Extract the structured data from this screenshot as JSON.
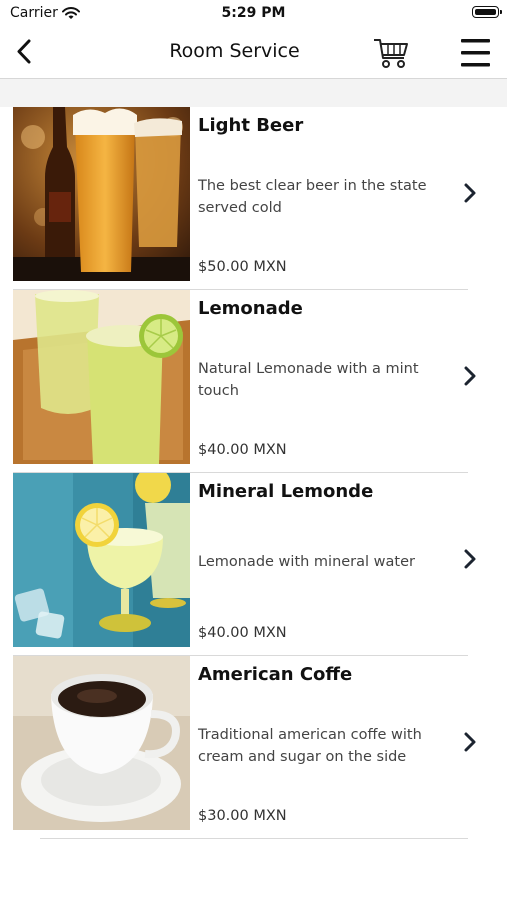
{
  "status_bar": {
    "carrier": "Carrier",
    "time": "5:29 PM"
  },
  "header": {
    "title": "Room Service",
    "back_icon": "chevron-left-icon",
    "cart_icon": "cart-icon",
    "menu_icon": "menu-icon"
  },
  "items": [
    {
      "name": "Light Beer",
      "description": "The best clear beer in the state served cold",
      "price": "$50.00 MXN",
      "image": "beer-glasses"
    },
    {
      "name": "Lemonade",
      "description": "Natural Lemonade with a mint touch",
      "price": "$40.00 MXN",
      "image": "lemonade-glasses"
    },
    {
      "name": "Mineral Lemonde",
      "description": "Lemonade with mineral water",
      "price": "$40.00 MXN",
      "image": "mineral-lemonade-glasses"
    },
    {
      "name": "American Coffe",
      "description": "Traditional american coffe with cream and sugar on the side",
      "price": "$30.00 MXN",
      "image": "coffee-cup"
    }
  ],
  "colors": {
    "separator": "#d9d9d9",
    "text": "#111111",
    "muted": "#444444"
  }
}
